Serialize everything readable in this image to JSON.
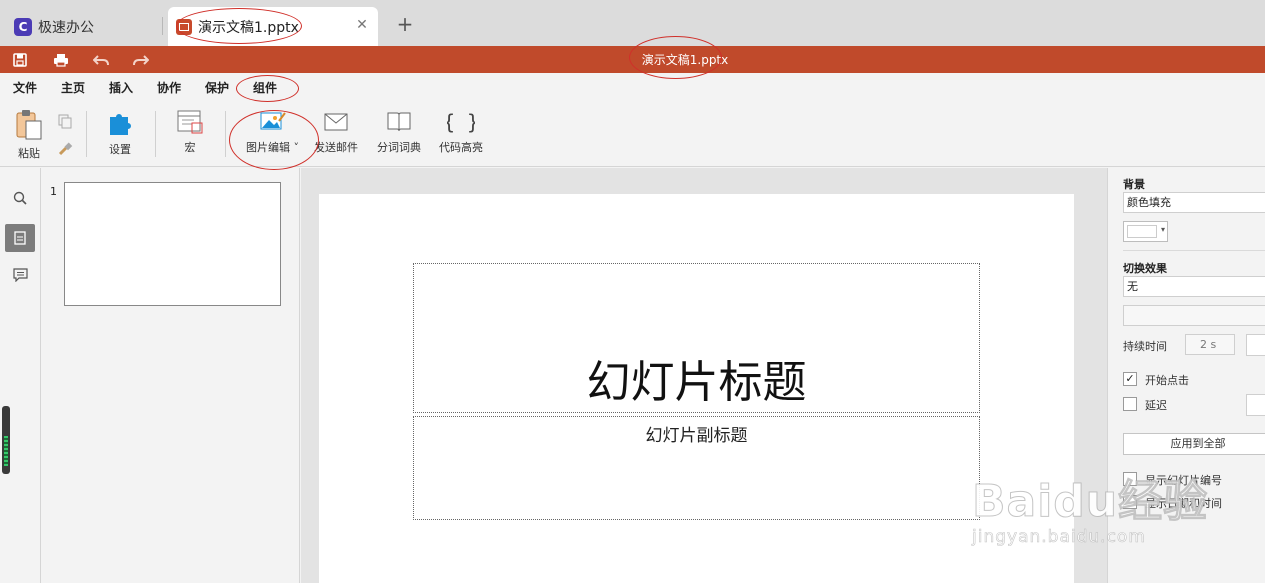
{
  "tabs": {
    "home_label": "极速办公",
    "doc_label": "演示文稿1.pptx",
    "close_glyph": "✕",
    "add_glyph": "+"
  },
  "titlebar": {
    "title": "演示文稿1.pptx",
    "color": "#c04a2b"
  },
  "menu": {
    "items": [
      "文件",
      "主页",
      "插入",
      "协作",
      "保护",
      "组件"
    ],
    "active": "组件"
  },
  "ribbon": {
    "paste": "粘贴",
    "settings": "设置",
    "macro": "宏",
    "image_edit": "图片编辑",
    "send_mail": "发送邮件",
    "dictionary": "分词词典",
    "code_highlight": "代码高亮"
  },
  "thumbnails": {
    "slide_number": "1"
  },
  "slide": {
    "title": "幻灯片标题",
    "subtitle": "幻灯片副标题"
  },
  "right_panel": {
    "background_heading": "背景",
    "fill_value": "颜色填充",
    "transition_heading": "切换效果",
    "transition_value": "无",
    "duration_label": "持续时间",
    "duration_value": "2 s",
    "start_on_click": "开始点击",
    "start_on_click_checked": true,
    "delay_label": "延迟",
    "apply_all": "应用到全部",
    "show_slide_number": "显示幻灯片编号",
    "show_date_time": "显示日期和时间"
  },
  "watermark": {
    "logo": "Baidu经验",
    "url": "jingyan.baidu.com"
  }
}
